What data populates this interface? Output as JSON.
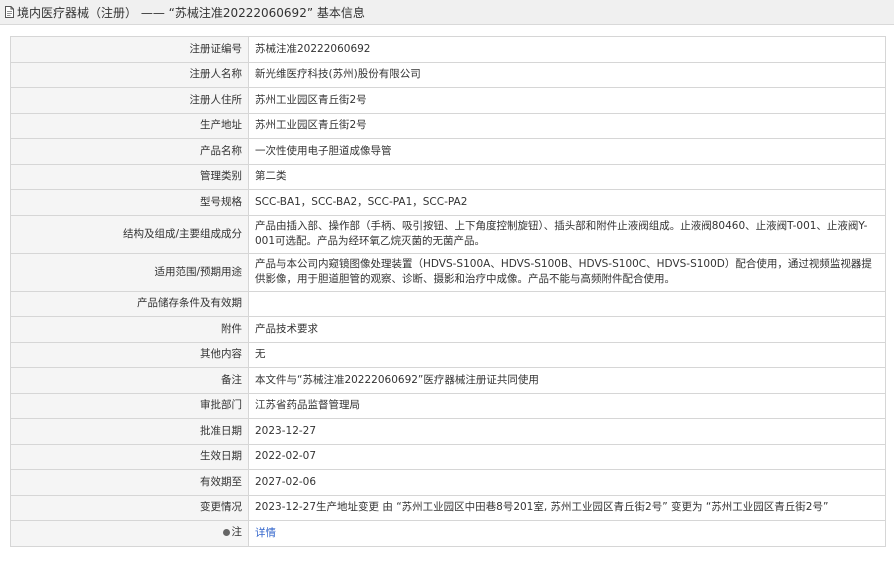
{
  "header": {
    "title": "境内医疗器械（注册） —— “苏械注准20222060692” 基本信息",
    "icon": "document-icon"
  },
  "rows": [
    {
      "label": "注册证编号",
      "value": "苏械注准20222060692"
    },
    {
      "label": "注册人名称",
      "value": "新光维医疗科技(苏州)股份有限公司"
    },
    {
      "label": "注册人住所",
      "value": "苏州工业园区青丘街2号"
    },
    {
      "label": "生产地址",
      "value": "苏州工业园区青丘街2号"
    },
    {
      "label": "产品名称",
      "value": "一次性使用电子胆道成像导管"
    },
    {
      "label": "管理类别",
      "value": "第二类"
    },
    {
      "label": "型号规格",
      "value": "SCC-BA1，SCC-BA2，SCC-PA1，SCC-PA2"
    },
    {
      "label": "结构及组成/主要组成成分",
      "value": "产品由插入部、操作部（手柄、吸引按钮、上下角度控制旋钮）、插头部和附件止液阀组成。止液阀80460、止液阀T-001、止液阀Y-001可选配。产品为经环氧乙烷灭菌的无菌产品。"
    },
    {
      "label": "适用范围/预期用途",
      "value": "产品与本公司内窥镜图像处理装置（HDVS-S100A、HDVS-S100B、HDVS-S100C、HDVS-S100D）配合使用，通过视频监视器提供影像，用于胆道胆管的观察、诊断、摄影和治疗中成像。产品不能与高频附件配合使用。"
    },
    {
      "label": "产品储存条件及有效期",
      "value": ""
    },
    {
      "label": "附件",
      "value": "产品技术要求"
    },
    {
      "label": "其他内容",
      "value": "无"
    },
    {
      "label": "备注",
      "value": "本文件与“苏械注准20222060692”医疗器械注册证共同使用"
    },
    {
      "label": "审批部门",
      "value": "江苏省药品监督管理局"
    },
    {
      "label": "批准日期",
      "value": "2023-12-27"
    },
    {
      "label": "生效日期",
      "value": "2022-02-07"
    },
    {
      "label": "有效期至",
      "value": "2027-02-06"
    },
    {
      "label": "变更情况",
      "value": "2023-12-27生产地址变更 由 “苏州工业园区中田巷8号201室, 苏州工业园区青丘街2号” 变更为 “苏州工业园区青丘街2号”"
    },
    {
      "label": "注",
      "value": "详情",
      "link": true
    }
  ],
  "colors": {
    "label_bg": "#f5f5f5",
    "border": "#d6d6d6",
    "link": "#3366cc",
    "header_bg": "#f0f0f0"
  }
}
